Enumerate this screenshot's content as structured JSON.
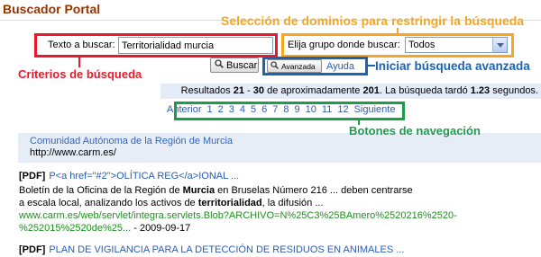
{
  "header": {
    "title": "Buscador Portal"
  },
  "search": {
    "text_label": "Texto a buscar:",
    "text_value": "Territorialidad murcia",
    "group_label": "Elija grupo donde buscar:",
    "group_selected": "Todos",
    "search_button": "Buscar",
    "advanced_button": "Avanzada",
    "help_link": "Ayuda"
  },
  "annotations": {
    "domain_selection": "Selección de dominios para restringir la búsqueda",
    "search_criteria": "Criterios de búsqueda",
    "advanced_search": "Iniciar búsqueda avanzada",
    "navigation_buttons": "Botones de navegación"
  },
  "results_summary": {
    "label": "Resultados ",
    "from": "21",
    "sep": " - ",
    "to": "30",
    "approx": " de aproximadamente ",
    "total": "201",
    "time_label": ". La búsqueda tardó ",
    "seconds": "1.23",
    "unit": " segundos."
  },
  "pagination": {
    "previous": "Anterior",
    "pages": [
      "1",
      "2",
      "3",
      "4",
      "5",
      "6",
      "7",
      "8",
      "9",
      "10",
      "11",
      "12"
    ],
    "next": "Siguiente"
  },
  "sponsored": {
    "title": "Comunidad Autónoma de la Región de Murcia",
    "url": "http://www.carm.es/"
  },
  "results": [
    {
      "type": "[PDF]",
      "title": "P<a href=\"#2\">OLÍTICA REG</a>IONAL ...",
      "snippet": [
        {
          "before": "Boletín de la Oficina de la Región de ",
          "bold": "Murcia",
          "after": " en Bruselas Número 216 ... deben centrarse"
        },
        {
          "before": "a escala local, analizando los activos de ",
          "bold": "territorialidad",
          "after": ", la difusión ..."
        }
      ],
      "url_lines": [
        "www.carm.es/web/servlet/integra.servlets.Blob?ARCHIVO=N%25C3%25BAmero%2520216%2520-",
        "%252015%2520de%25..."
      ],
      "date": " - 2009-09-17"
    },
    {
      "type": "[PDF]",
      "title": "PLAN DE VIGILANCIA PARA LA DETECCIÓN DE RESIDUOS EN ANIMALES ..."
    }
  ],
  "colors": {
    "title": "#993300",
    "link": "#2a5db0",
    "url": "#1f8f1f",
    "annotation_red": "#e8192c",
    "annotation_orange": "#f5a623",
    "annotation_blue": "#1a64b8",
    "annotation_green": "#1f9c4b",
    "results_bar_bg": "#e5ecf9",
    "sponsored_bg": "#e7edf6"
  },
  "icons": {
    "search_button": "magnifier-icon",
    "advanced_button": "magnifier-icon",
    "group_select": "chevron-down-icon"
  }
}
